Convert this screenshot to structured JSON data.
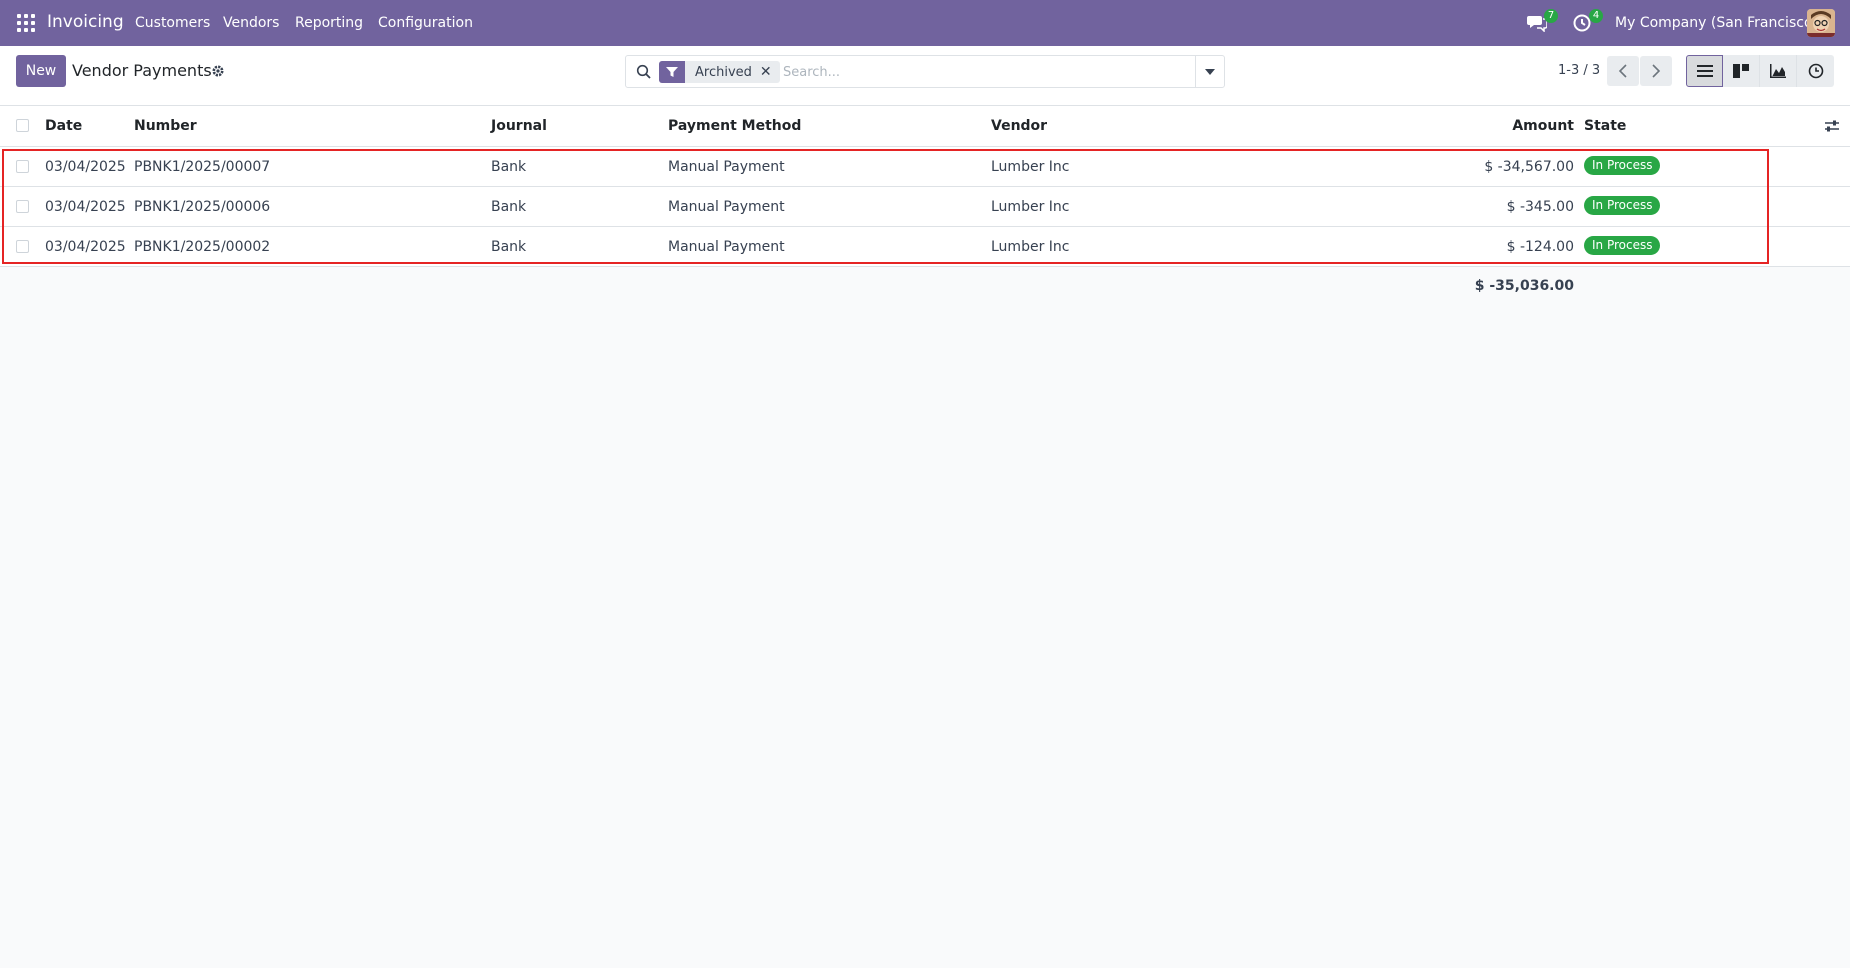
{
  "navbar": {
    "app_name": "Invoicing",
    "menu": [
      "Customers",
      "Vendors",
      "Reporting",
      "Configuration"
    ],
    "messages_count": "7",
    "activities_count": "4",
    "company": "My Company (San Francisco)"
  },
  "control": {
    "new_label": "New",
    "title": "Vendor Payments",
    "facet_label": "Archived",
    "search_placeholder": "Search...",
    "pager": "1-3 / 3"
  },
  "table": {
    "columns": {
      "date": "Date",
      "number": "Number",
      "journal": "Journal",
      "payment_method": "Payment Method",
      "vendor": "Vendor",
      "amount": "Amount",
      "state": "State"
    },
    "rows": [
      {
        "date": "03/04/2025",
        "number": "PBNK1/2025/00007",
        "journal": "Bank",
        "payment_method": "Manual Payment",
        "vendor": "Lumber Inc",
        "amount": "$ -34,567.00",
        "state": "In Process"
      },
      {
        "date": "03/04/2025",
        "number": "PBNK1/2025/00006",
        "journal": "Bank",
        "payment_method": "Manual Payment",
        "vendor": "Lumber Inc",
        "amount": "$ -345.00",
        "state": "In Process"
      },
      {
        "date": "03/04/2025",
        "number": "PBNK1/2025/00002",
        "journal": "Bank",
        "payment_method": "Manual Payment",
        "vendor": "Lumber Inc",
        "amount": "$ -124.00",
        "state": "In Process"
      }
    ],
    "total": "$ -35,036.00"
  },
  "colors": {
    "brand": "#71639e",
    "success": "#28a745",
    "highlight": "#e52424"
  }
}
